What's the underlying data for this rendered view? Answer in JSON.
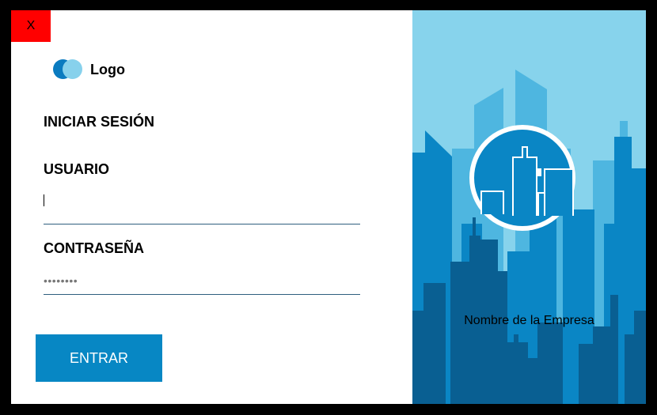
{
  "window": {
    "close_label": "X"
  },
  "logo": {
    "text": "Logo"
  },
  "login": {
    "title": "INICIAR SESIÓN",
    "username_label": "USUARIO",
    "username_value": "",
    "password_label": "CONTRASEÑA",
    "password_value": "••••••••",
    "submit_label": "ENTRAR"
  },
  "brand_panel": {
    "company_name": "Nombre de la Empresa",
    "emblem_icon": "city-buildings-icon"
  },
  "colors": {
    "close_button": "#ff0000",
    "primary_button": "#0787c4",
    "logo_dark": "#0a7bc0",
    "logo_light": "#87d1ec",
    "sky": "#87d3ec",
    "building_light": "#4eb6e0",
    "building_mid": "#0a86c5",
    "building_dark": "#095f92"
  }
}
